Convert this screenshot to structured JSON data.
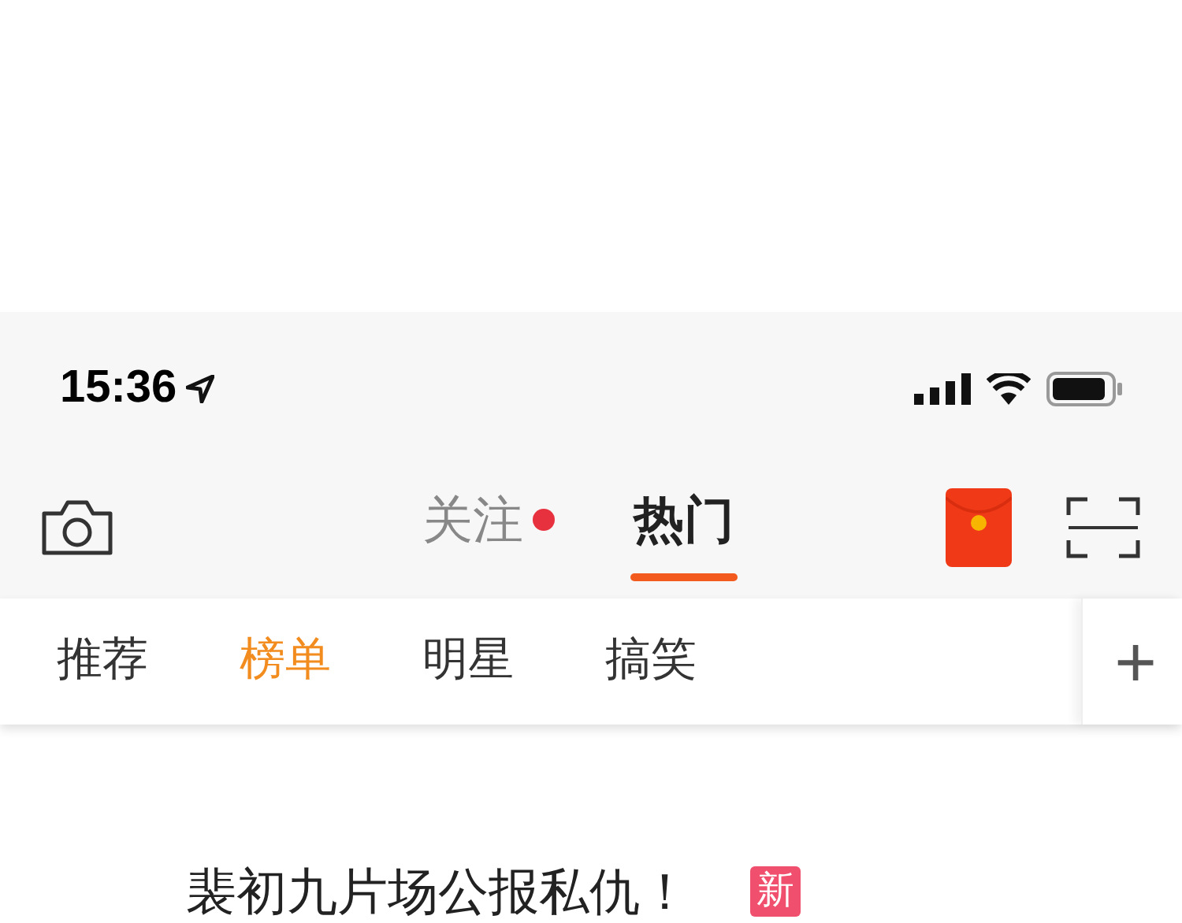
{
  "status_bar": {
    "time": "15:36"
  },
  "main_tabs": [
    {
      "label": "关注",
      "selected": false,
      "dot": true
    },
    {
      "label": "热门",
      "selected": true,
      "dot": false
    }
  ],
  "sub_tabs": [
    {
      "label": "推荐",
      "selected": false
    },
    {
      "label": "榜单",
      "selected": true
    },
    {
      "label": "明星",
      "selected": false
    },
    {
      "label": "搞笑",
      "selected": false
    }
  ],
  "sub_tabs_add": "+",
  "headline": {
    "text": "裴初九片场公报私仇！",
    "badge": "新"
  }
}
